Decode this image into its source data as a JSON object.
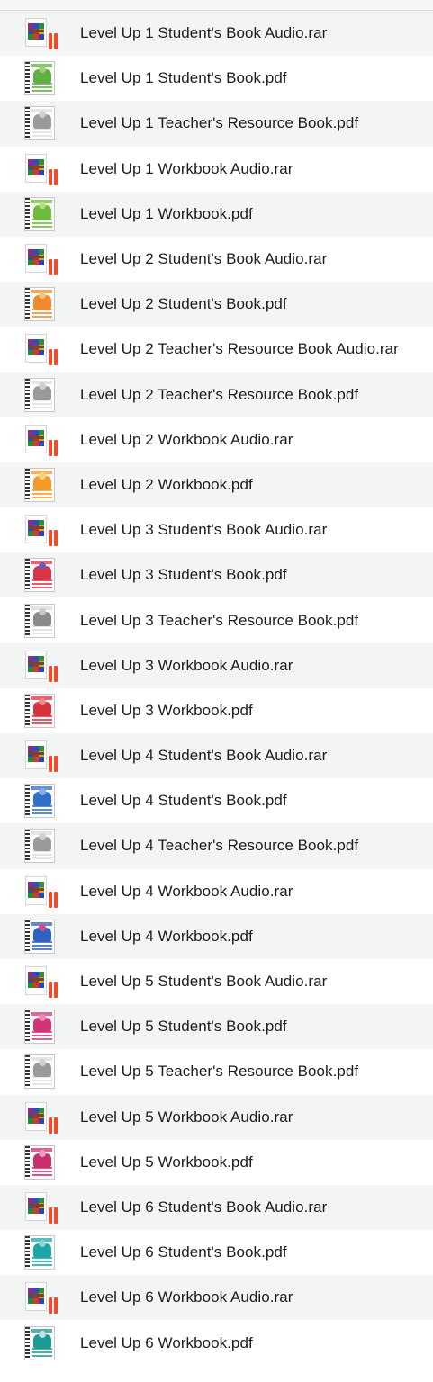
{
  "files": [
    {
      "name": "Level Up 1 Student's Book Audio.rar",
      "type": "rar",
      "icon": "rar-archive-icon"
    },
    {
      "name": "Level Up 1 Student's Book.pdf",
      "type": "pdf",
      "icon": "book-cover-icon",
      "color": "#5fb043",
      "color2": "#9ad27b"
    },
    {
      "name": "Level Up 1 Teacher's Resource Book.pdf",
      "type": "pdf",
      "icon": "book-cover-icon",
      "color": "#9a9a9a",
      "color2": "#d0d0d0",
      "teacher": true
    },
    {
      "name": "Level Up 1 Workbook Audio.rar",
      "type": "rar",
      "icon": "rar-archive-icon"
    },
    {
      "name": "Level Up 1 Workbook.pdf",
      "type": "pdf",
      "icon": "book-cover-icon",
      "color": "#6cbb3c",
      "color2": "#b8e07c"
    },
    {
      "name": "Level Up 2 Student's Book Audio.rar",
      "type": "rar",
      "icon": "rar-archive-icon"
    },
    {
      "name": "Level Up 2 Student's Book.pdf",
      "type": "pdf",
      "icon": "book-cover-icon",
      "color": "#ef8a2e",
      "color2": "#f6c77a"
    },
    {
      "name": "Level Up 2 Teacher's Resource Book Audio.rar",
      "type": "rar",
      "icon": "rar-archive-icon"
    },
    {
      "name": "Level Up 2 Teacher's Resource Book.pdf",
      "type": "pdf",
      "icon": "book-cover-icon",
      "color": "#9a9a9a",
      "color2": "#d0d0d0",
      "teacher": true
    },
    {
      "name": "Level Up 2 Workbook Audio.rar",
      "type": "rar",
      "icon": "rar-archive-icon"
    },
    {
      "name": "Level Up 2 Workbook.pdf",
      "type": "pdf",
      "icon": "book-cover-icon",
      "color": "#f29a2a",
      "color2": "#f8d27b"
    },
    {
      "name": "Level Up 3 Student's Book Audio.rar",
      "type": "rar",
      "icon": "rar-archive-icon"
    },
    {
      "name": "Level Up 3 Student's Book.pdf",
      "type": "pdf",
      "icon": "book-cover-icon",
      "color": "#d8344a",
      "color2": "#6b5bb5"
    },
    {
      "name": "Level Up 3 Teacher's Resource Book.pdf",
      "type": "pdf",
      "icon": "book-cover-icon",
      "color": "#8a8a8a",
      "color2": "#c8c8c8",
      "teacher": true
    },
    {
      "name": "Level Up 3 Workbook Audio.rar",
      "type": "rar",
      "icon": "rar-archive-icon"
    },
    {
      "name": "Level Up 3 Workbook.pdf",
      "type": "pdf",
      "icon": "book-cover-icon",
      "color": "#d9323f",
      "color2": "#f28a8a"
    },
    {
      "name": "Level Up 4 Student's Book Audio.rar",
      "type": "rar",
      "icon": "rar-archive-icon"
    },
    {
      "name": "Level Up 4 Student's Book.pdf",
      "type": "pdf",
      "icon": "book-cover-icon",
      "color": "#2f6fc9",
      "color2": "#7fb0ea"
    },
    {
      "name": "Level Up 4 Teacher's Resource Book.pdf",
      "type": "pdf",
      "icon": "book-cover-icon",
      "color": "#9a9a9a",
      "color2": "#d0d0d0",
      "teacher": true
    },
    {
      "name": "Level Up 4 Workbook Audio.rar",
      "type": "rar",
      "icon": "rar-archive-icon"
    },
    {
      "name": "Level Up 4 Workbook.pdf",
      "type": "pdf",
      "icon": "book-cover-icon",
      "color": "#2e63c0",
      "color2": "#d64a8a"
    },
    {
      "name": "Level Up 5 Student's Book Audio.rar",
      "type": "rar",
      "icon": "rar-archive-icon"
    },
    {
      "name": "Level Up 5 Student's Book.pdf",
      "type": "pdf",
      "icon": "book-cover-icon",
      "color": "#d23477",
      "color2": "#f08ab5"
    },
    {
      "name": "Level Up 5 Teacher's Resource Book.pdf",
      "type": "pdf",
      "icon": "book-cover-icon",
      "color": "#9a9a9a",
      "color2": "#d0d0d0",
      "teacher": true
    },
    {
      "name": "Level Up 5 Workbook Audio.rar",
      "type": "rar",
      "icon": "rar-archive-icon"
    },
    {
      "name": "Level Up 5 Workbook.pdf",
      "type": "pdf",
      "icon": "book-cover-icon",
      "color": "#c92f6e",
      "color2": "#ef9cc0"
    },
    {
      "name": "Level Up 6 Student's Book Audio.rar",
      "type": "rar",
      "icon": "rar-archive-icon"
    },
    {
      "name": "Level Up 6 Student's Book.pdf",
      "type": "pdf",
      "icon": "book-cover-icon",
      "color": "#1ea6a6",
      "color2": "#86d9d6"
    },
    {
      "name": "Level Up 6 Workbook Audio.rar",
      "type": "rar",
      "icon": "rar-archive-icon"
    },
    {
      "name": "Level Up 6 Workbook.pdf",
      "type": "pdf",
      "icon": "book-cover-icon",
      "color": "#1a9b94",
      "color2": "#b9e5e1"
    }
  ]
}
